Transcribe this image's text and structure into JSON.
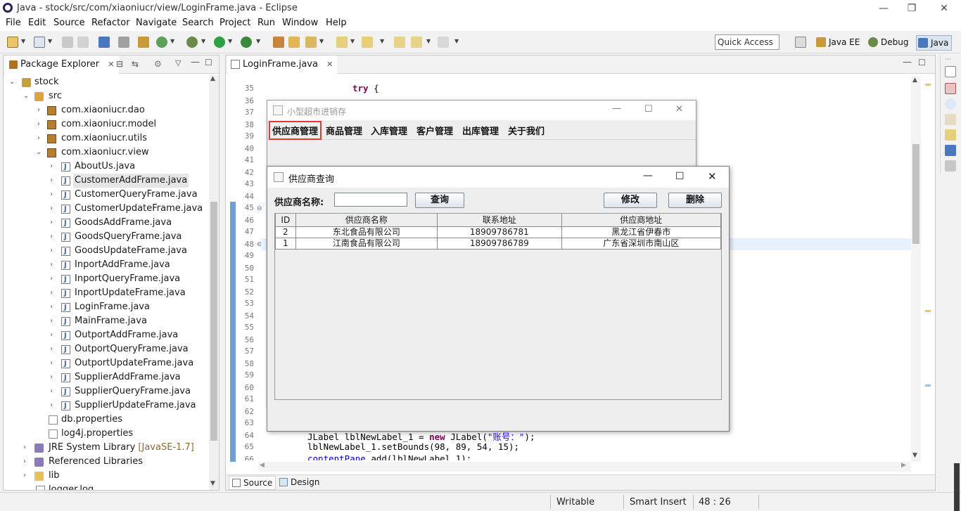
{
  "window": {
    "title": "Java - stock/src/com/xiaoniucr/view/LoginFrame.java - Eclipse"
  },
  "menu": [
    "File",
    "Edit",
    "Source",
    "Refactor",
    "Navigate",
    "Search",
    "Project",
    "Run",
    "Window",
    "Help"
  ],
  "toolbar": {
    "quick_access": "Quick Access",
    "perspectives": [
      "Java EE",
      "Debug",
      "Java"
    ]
  },
  "package_explorer": {
    "tab_label": "Package Explorer",
    "project": "stock",
    "src": "src",
    "packages": [
      "com.xiaoniucr.dao",
      "com.xiaoniucr.model",
      "com.xiaoniucr.utils",
      "com.xiaoniucr.view"
    ],
    "files": [
      "AboutUs.java",
      "CustomerAddFrame.java",
      "CustomerQueryFrame.java",
      "CustomerUpdateFrame.java",
      "GoodsAddFrame.java",
      "GoodsQueryFrame.java",
      "GoodsUpdateFrame.java",
      "InportAddFrame.java",
      "InportQueryFrame.java",
      "InportUpdateFrame.java",
      "LoginFrame.java",
      "MainFrame.java",
      "OutportAddFrame.java",
      "OutportQueryFrame.java",
      "OutportUpdateFrame.java",
      "SupplierAddFrame.java",
      "SupplierQueryFrame.java",
      "SupplierUpdateFrame.java"
    ],
    "selected_file": "CustomerAddFrame.java",
    "props": [
      "db.properties",
      "log4j.properties"
    ],
    "jre": "JRE System Library",
    "jre_tag": "[JavaSE-1.7]",
    "referenced": "Referenced Libraries",
    "lib": "lib",
    "logger": "logger.log"
  },
  "editor": {
    "tab_label": "LoginFrame.java",
    "line_numbers": [
      "35",
      "36",
      "37",
      "38",
      "39",
      "40",
      "41",
      "42",
      "43",
      "44",
      "45",
      "46",
      "47",
      "48",
      "49",
      "50",
      "51",
      "52",
      "53",
      "54",
      "55",
      "56",
      "57",
      "58",
      "59",
      "60",
      "61",
      "62",
      "63",
      "64",
      "65",
      "66"
    ],
    "code_35_kw": "try",
    "code_35_rest": " {",
    "code_64_pre": "JLabel lblNewLabel_1 = ",
    "code_64_kw": "new",
    "code_64_mid": " JLabel(",
    "code_64_str": "\"账号：\"",
    "code_64_end": ");",
    "code_65": "lblNewLabel_1.setBounds(98, 89, 54, 15);",
    "code_66_fld": "contentPane",
    "code_66_rest": ".add(lblNewLabel_1);",
    "source_tab": "Source",
    "design_tab": "Design"
  },
  "status": {
    "writable": "Writable",
    "insert": "Smart Insert",
    "position": "48 : 26"
  },
  "main_frame": {
    "title": "小型超市进销存",
    "menus": [
      "供应商管理",
      "商品管理",
      "入库管理",
      "客户管理",
      "出库管理",
      "关于我们"
    ]
  },
  "dialog": {
    "title": "供应商查询",
    "label": "供应商名称:",
    "input_value": "",
    "query_button": "查询",
    "edit_button": "修改",
    "delete_button": "删除",
    "columns": [
      "ID",
      "供应商名称",
      "联系地址",
      "供应商地址"
    ],
    "rows": [
      [
        "2",
        "东北食品有限公司",
        "18909786781",
        "黑龙江省伊春市"
      ],
      [
        "1",
        "江南食品有限公司",
        "18909786789",
        "广东省深圳市南山区"
      ]
    ]
  }
}
